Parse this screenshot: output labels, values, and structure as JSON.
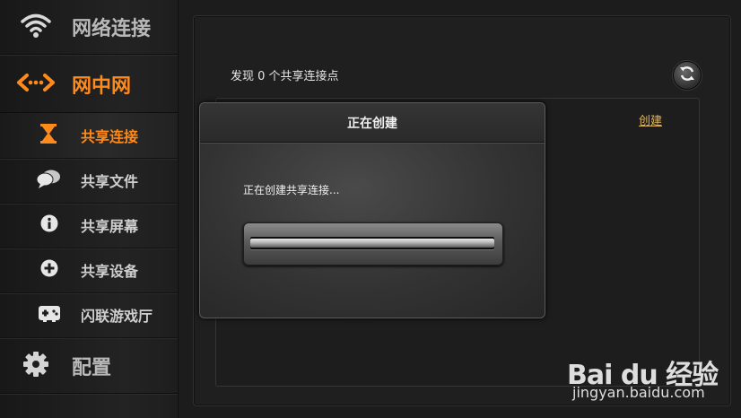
{
  "sidebar": {
    "network": {
      "label": "网络连接",
      "icon": "wifi-icon"
    },
    "netinnet": {
      "label": "网中网",
      "icon": "network-arrows-icon"
    },
    "items": [
      {
        "label": "共享连接",
        "icon": "hourglass-icon",
        "active": true
      },
      {
        "label": "共享文件",
        "icon": "chat-bubbles-icon"
      },
      {
        "label": "共享屏幕",
        "icon": "info-icon"
      },
      {
        "label": "共享设备",
        "icon": "plus-circle-icon"
      },
      {
        "label": "闪联游戏厅",
        "icon": "gamepad-icon"
      }
    ],
    "settings": {
      "label": "配置",
      "icon": "gear-icon"
    }
  },
  "main": {
    "found_text": "发现 0 个共享连接点",
    "create_link": "创建"
  },
  "dialog": {
    "title": "正在创建",
    "message": "正在创建共享连接...",
    "progress": 1.0
  },
  "watermark": {
    "logo": "Bai du 经验",
    "url": "jingyan.baidu.com"
  },
  "colors": {
    "accent": "#ff8a1c",
    "link": "#e2b55a",
    "background": "#1c1c1c"
  }
}
